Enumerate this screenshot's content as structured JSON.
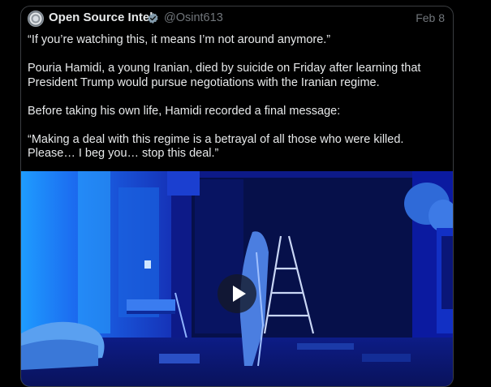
{
  "tweet": {
    "author_name": "Open Source Intel",
    "author_handle": "@Osint613",
    "date": "Feb 8",
    "paragraphs": [
      "“If you’re watching this, it means I’m not around anymore.”",
      "Pouria Hamidi, a young Iranian, died by suicide on Friday after learning that President Trump would pursue negotiations with the Iranian regime.",
      "Before taking his own life, Hamidi recorded a final message:",
      "“Making a deal with this regime is a betrayal of all those who were killed. Please… I beg you… stop this deal.”"
    ]
  },
  "icons": {
    "avatar": "avatar-icon",
    "verified": "verified-badge-icon",
    "play": "play-icon"
  },
  "colors": {
    "background": "#000000",
    "text_primary": "#e7e9ea",
    "text_secondary": "#71767b",
    "verified_badge": "#829aab",
    "video_tint": "#1a2ad8"
  }
}
